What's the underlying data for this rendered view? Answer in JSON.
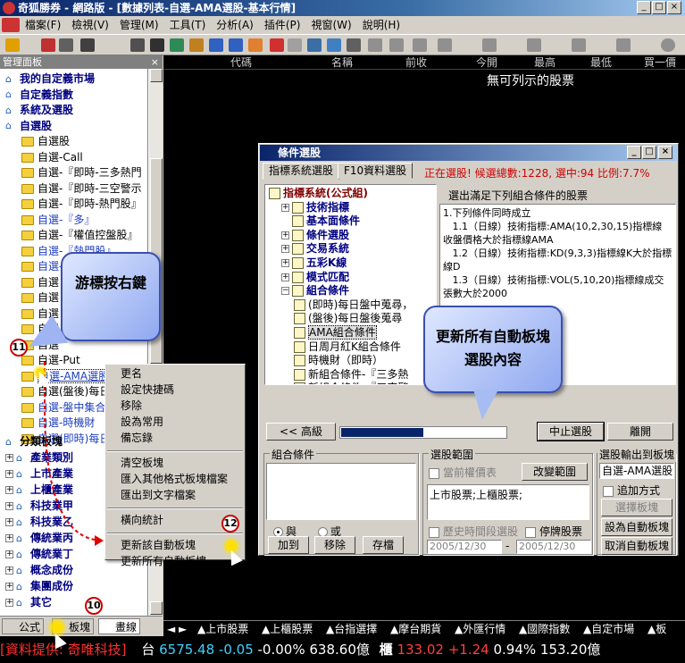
{
  "window": {
    "title": "奇狐勝券 - 網路版 - [數據列表-自選-AMA選股-基本行情]"
  },
  "menu": [
    "檔案(F)",
    "檢視(V)",
    "管理(M)",
    "工具(T)",
    "分析(A)",
    "插件(P)",
    "視窗(W)",
    "說明(H)"
  ],
  "panel": {
    "title": "管理面板"
  },
  "tree": [
    {
      "label": "我的自定義市場",
      "kind": "home",
      "bold": true,
      "color": "#000080"
    },
    {
      "label": "自定義指數",
      "kind": "home",
      "bold": true,
      "color": "#000080"
    },
    {
      "label": "系統及選股",
      "kind": "home",
      "bold": true,
      "color": "#000080"
    },
    {
      "label": "自選股",
      "kind": "home",
      "bold": true,
      "color": "#000080"
    },
    {
      "label": "自選股",
      "kind": "folder",
      "color": "#000"
    },
    {
      "label": "自選-Call",
      "kind": "folder",
      "color": "#000"
    },
    {
      "label": "自選-『即時-三多熱門",
      "kind": "folder",
      "color": "#000"
    },
    {
      "label": "自選-『即時-三空警示",
      "kind": "folder",
      "color": "#000"
    },
    {
      "label": "自選-『即時-熱門股』",
      "kind": "folder",
      "color": "#000"
    },
    {
      "label": "自選-『多』",
      "kind": "folder",
      "color": "#1f3fbf"
    },
    {
      "label": "自選-『權值控盤股』",
      "kind": "folder",
      "color": "#000"
    },
    {
      "label": "自選-『熱門股』",
      "kind": "folder",
      "color": "#1f3fbf"
    },
    {
      "label": "自選-『空』",
      "kind": "folder",
      "color": "#1f3fbf"
    },
    {
      "label": "自選",
      "kind": "folder",
      "color": "#000"
    },
    {
      "label": "自選",
      "kind": "folder",
      "color": "#000"
    },
    {
      "label": "自選",
      "kind": "folder",
      "color": "#000"
    },
    {
      "label": "自選",
      "kind": "folder",
      "color": "#000"
    },
    {
      "label": "自選",
      "kind": "folder",
      "color": "#000"
    },
    {
      "label": "自選-Put",
      "kind": "folder",
      "color": "#000"
    },
    {
      "label": "自選-AMA選股",
      "kind": "folder",
      "color": "#1f3fbf",
      "selected": true
    },
    {
      "label": "自選(盤後)每日",
      "kind": "folder",
      "color": "#000"
    },
    {
      "label": "自選-盤中集合",
      "kind": "folder",
      "color": "#1f3fbf"
    },
    {
      "label": "自選-時機財",
      "kind": "folder",
      "color": "#1f3fbf"
    },
    {
      "label": "自選(即時)每日",
      "kind": "folder",
      "color": "#1f3fbf"
    },
    {
      "label": "分類板塊",
      "kind": "home",
      "bold": true,
      "color": "#000"
    },
    {
      "label": "產業類別",
      "kind": "plus",
      "bold": true,
      "color": "#000080"
    },
    {
      "label": "上市產業",
      "kind": "plus",
      "bold": true,
      "color": "#000080"
    },
    {
      "label": "上櫃產業",
      "kind": "plus",
      "bold": true,
      "color": "#000080"
    },
    {
      "label": "科技業甲",
      "kind": "plus",
      "bold": true,
      "color": "#000080"
    },
    {
      "label": "科技業乙",
      "kind": "plus",
      "bold": true,
      "color": "#000080"
    },
    {
      "label": "傳統業丙",
      "kind": "plus",
      "bold": true,
      "color": "#000080"
    },
    {
      "label": "傳統業丁",
      "kind": "plus",
      "bold": true,
      "color": "#000080"
    },
    {
      "label": "概念成份",
      "kind": "plus",
      "bold": true,
      "color": "#000080"
    },
    {
      "label": "集團成份",
      "kind": "plus",
      "bold": true,
      "color": "#000080"
    },
    {
      "label": "其它",
      "kind": "plus",
      "bold": true,
      "color": "#000080"
    }
  ],
  "bottom_tabs": [
    "公式",
    "板塊",
    "畫線"
  ],
  "columns": [
    "代碼",
    "名稱",
    "前收",
    "今開",
    "最高",
    "最低",
    "買一價"
  ],
  "no_stock": "無可列示的股票",
  "ticker_tabs": [
    "▲上市股票",
    "▲上櫃股票",
    "▲台指選擇",
    "▲摩台期貨",
    "▲外匯行情",
    "▲國際指數",
    "▲自定市場",
    "▲板"
  ],
  "status": {
    "provider": "[資料提供: 奇唯科技]",
    "tw_label": "台",
    "tw_index": "6575.48",
    "tw_change": "-0.05",
    "tw_pct": "-0.00%",
    "tw_volume": "638.60億",
    "otc_label": "櫃",
    "otc_index": "133.02",
    "otc_change": "+1.24",
    "otc_pct": "0.94%",
    "otc_volume": "153.20億"
  },
  "dialog": {
    "title": "條件選股",
    "tab1": "指標系統選股",
    "tab2": "F10資料選股",
    "status_text": "正在選股! 候選總數:1228, 選中:94 比例:7.7%",
    "tree": [
      {
        "label": "指標系統(公式組)",
        "indent": 0,
        "bold": true,
        "color": "#800000",
        "expander": "",
        "icon": "F"
      },
      {
        "label": "技術指標",
        "indent": 1,
        "bold": true,
        "color": "#000080",
        "expander": "+",
        "icon": "T"
      },
      {
        "label": "基本面條件",
        "indent": 1,
        "bold": true,
        "color": "#000080",
        "expander": "",
        "icon": "B"
      },
      {
        "label": "條件選股",
        "indent": 1,
        "bold": true,
        "color": "#000080",
        "expander": "+",
        "icon": "C"
      },
      {
        "label": "交易系統",
        "indent": 1,
        "bold": true,
        "color": "#000080",
        "expander": "+",
        "icon": "E"
      },
      {
        "label": "五彩K線",
        "indent": 1,
        "bold": true,
        "color": "#000080",
        "expander": "+",
        "icon": "K"
      },
      {
        "label": "模式匹配",
        "indent": 1,
        "bold": true,
        "color": "#000080",
        "expander": "+",
        "icon": "M"
      },
      {
        "label": "組合條件",
        "indent": 1,
        "bold": true,
        "color": "#000080",
        "expander": "−",
        "icon": "G"
      },
      {
        "label": "(即時)每日盤中蒐尋，",
        "indent": 2,
        "bold": false,
        "color": "#000",
        "expander": "",
        "icon": "s"
      },
      {
        "label": "(盤後)每日盤後蒐尋",
        "indent": 2,
        "bold": false,
        "color": "#000",
        "expander": "",
        "icon": "s"
      },
      {
        "label": "AMA組合條件",
        "indent": 2,
        "bold": false,
        "color": "#000",
        "expander": "",
        "icon": "s",
        "selected": true
      },
      {
        "label": "日周月紅K組合條件",
        "indent": 2,
        "bold": false,
        "color": "#000",
        "expander": "",
        "icon": "s"
      },
      {
        "label": "時機財（即時）",
        "indent": 2,
        "bold": false,
        "color": "#000",
        "expander": "",
        "icon": "s"
      },
      {
        "label": "新組合條件-『三多熱",
        "indent": 2,
        "bold": false,
        "color": "#000",
        "expander": "",
        "icon": "s"
      },
      {
        "label": "新組合條件-『三空警",
        "indent": 2,
        "bold": false,
        "color": "#000",
        "expander": "",
        "icon": "s"
      }
    ],
    "desc_label": "選出滿足下列組合條件的股票",
    "desc_lines": [
      "1.下列條件同時成立",
      "   1.1（日線）技術指標:AMA(10,2,30,15)指標線",
      "收盤價格大於指標線AMA",
      "   1.2（日線）技術指標:KD(9,3,3)指標線K大於指標",
      "線D",
      "   1.3（日線）技術指標:VOL(5,10,20)指標線成交",
      "張數大於2000"
    ],
    "btn_advanced": "<< 高級",
    "progress": 0.5,
    "btn_stop": "中止選股",
    "btn_leave": "離開",
    "combo_group": "組合條件",
    "radio_and": "與",
    "radio_or": "或",
    "btn_add": "加到",
    "btn_remove": "移除",
    "btn_save": "存檔",
    "range_group": "選股範圍",
    "cur_weight": "當前權價表",
    "btn_change_range": "改變範圍",
    "range_value": "上市股票;上櫃股票;",
    "history": "歷史時間段選股",
    "suspended": "停牌股票",
    "date_from": "2005/12/30",
    "date_sep": "-",
    "date_to": "2005/12/30",
    "output_group": "選股輸出到板塊",
    "output_block": "自選-AMA選股",
    "append_mode": "追加方式",
    "btn_choose_block": "選擇板塊",
    "btn_set_auto": "設為自動板塊",
    "btn_cancel_auto": "取消自動板塊"
  },
  "context_menu": [
    {
      "label": "更名"
    },
    {
      "label": "設定快捷碼"
    },
    {
      "label": "移除"
    },
    {
      "label": "設為常用"
    },
    {
      "label": "備忘錄"
    },
    {
      "sep": true
    },
    {
      "label": "清空板塊"
    },
    {
      "label": "匯入其他格式板塊檔案"
    },
    {
      "label": "匯出到文字檔案"
    },
    {
      "sep": true
    },
    {
      "label": "橫向統計"
    },
    {
      "sep": true
    },
    {
      "label": "更新該自動板塊"
    },
    {
      "label": "更新所有自動板塊"
    }
  ],
  "callouts": {
    "right_click": "游標按右鍵",
    "update_all": "更新所有自動板塊選股內容"
  },
  "markers": {
    "m10": "10",
    "m11": "11",
    "m12": "12"
  }
}
